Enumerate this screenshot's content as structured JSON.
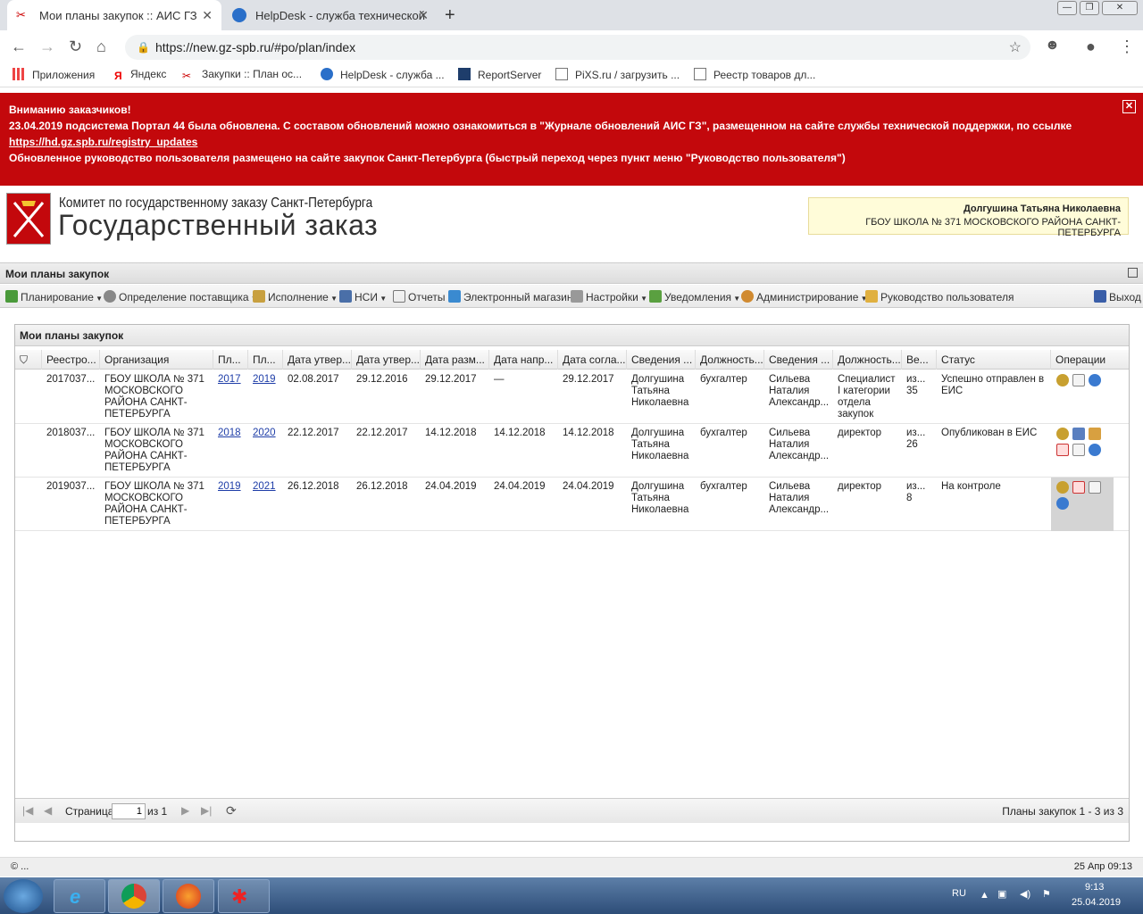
{
  "browser": {
    "tabs": [
      {
        "title": "Мои планы закупок :: АИС ГЗ",
        "active": true
      },
      {
        "title": "HelpDesk - служба технической",
        "active": false
      }
    ],
    "url": "https://new.gz-spb.ru/#po/plan/index",
    "bookmarks": [
      "Приложения",
      "Яндекс",
      "Закупки :: План ос...",
      "HelpDesk - служба ...",
      "ReportServer",
      "PiXS.ru / загрузить ...",
      "Реестр товаров дл..."
    ]
  },
  "notice": {
    "line1": "Вниманию заказчиков!",
    "line2": "23.04.2019 подсистема Портал 44 была обновлена. С составом обновлений можно ознакомиться в \"Журнале обновлений АИС ГЗ\", размещенном на сайте службы технической поддержки, по ссылке",
    "link": "https://hd.gz.spb.ru/registry_updates",
    "line3": "Обновленное руководство пользователя размещено на сайте закупок Санкт-Петербурга (быстрый переход через пункт меню \"Руководство пользователя\")"
  },
  "header": {
    "org_line1": "Комитет по государственному заказу Санкт-Петербурга",
    "org_line2": "Государственный заказ",
    "user_name": "Долгушина Татьяна Николаевна",
    "user_org": "ГБОУ ШКОЛА № 371 МОСКОВСКОГО РАЙОНА САНКТ-ПЕТЕРБУРГА"
  },
  "panel_title": "Мои планы закупок",
  "menu": [
    "Планирование",
    "Определение поставщика",
    "Исполнение",
    "НСИ",
    "Отчеты",
    "Электронный магазин",
    "Настройки",
    "Уведомления",
    "Администрирование",
    "Руководство пользователя",
    "Выход"
  ],
  "grid": {
    "title": "Мои планы закупок",
    "columns": [
      "Реестро...",
      "Организация",
      "Пл...",
      "Пл...",
      "Дата утвер...",
      "Дата утвер...",
      "Дата разм...",
      "Дата напр...",
      "Дата согла...",
      "Сведения ...",
      "Должность...",
      "Сведения ...",
      "Должность...",
      "Ве...",
      "Статус",
      "Операции"
    ],
    "rows": [
      {
        "reg": "2017037...",
        "org": "ГБОУ ШКОЛА № 371 МОСКОВСКОГО РАЙОНА САНКТ-ПЕТЕРБУРГА",
        "p1": "2017",
        "p2": "2019",
        "d1": "02.08.2017",
        "d2": "29.12.2016",
        "d3": "29.12.2017",
        "d4": "—",
        "d5": "29.12.2017",
        "s1": "Долгушина Татьяна Николаевна",
        "pos1": "бухгалтер",
        "s2": "Сильева Наталия Александр...",
        "pos2": "Специалист I категории отдела закупок",
        "ver": "из... 35",
        "status": "Успешно отправлен в ЕИС"
      },
      {
        "reg": "2018037...",
        "org": "ГБОУ ШКОЛА № 371 МОСКОВСКОГО РАЙОНА САНКТ-ПЕТЕРБУРГА",
        "p1": "2018",
        "p2": "2020",
        "d1": "22.12.2017",
        "d2": "22.12.2017",
        "d3": "14.12.2018",
        "d4": "14.12.2018",
        "d5": "14.12.2018",
        "s1": "Долгушина Татьяна Николаевна",
        "pos1": "бухгалтер",
        "s2": "Сильева Наталия Александр...",
        "pos2": "директор",
        "ver": "из... 26",
        "status": "Опубликован в ЕИС"
      },
      {
        "reg": "2019037...",
        "org": "ГБОУ ШКОЛА № 371 МОСКОВСКОГО РАЙОНА САНКТ-ПЕТЕРБУРГА",
        "p1": "2019",
        "p2": "2021",
        "d1": "26.12.2018",
        "d2": "26.12.2018",
        "d3": "24.04.2019",
        "d4": "24.04.2019",
        "d5": "24.04.2019",
        "s1": "Долгушина Татьяна Николаевна",
        "pos1": "бухгалтер",
        "s2": "Сильева Наталия Александр...",
        "pos2": "директор",
        "ver": "из... 8",
        "status": "На контроле"
      }
    ]
  },
  "pager": {
    "page_label": "Страница",
    "page": "1",
    "of": "из 1",
    "summary": "Планы закупок 1 - 3 из 3"
  },
  "statusbar": {
    "left": "© ...",
    "right": "25 Апр 09:13"
  },
  "taskbar": {
    "lang": "RU",
    "time": "9:13",
    "date": "25.04.2019"
  }
}
